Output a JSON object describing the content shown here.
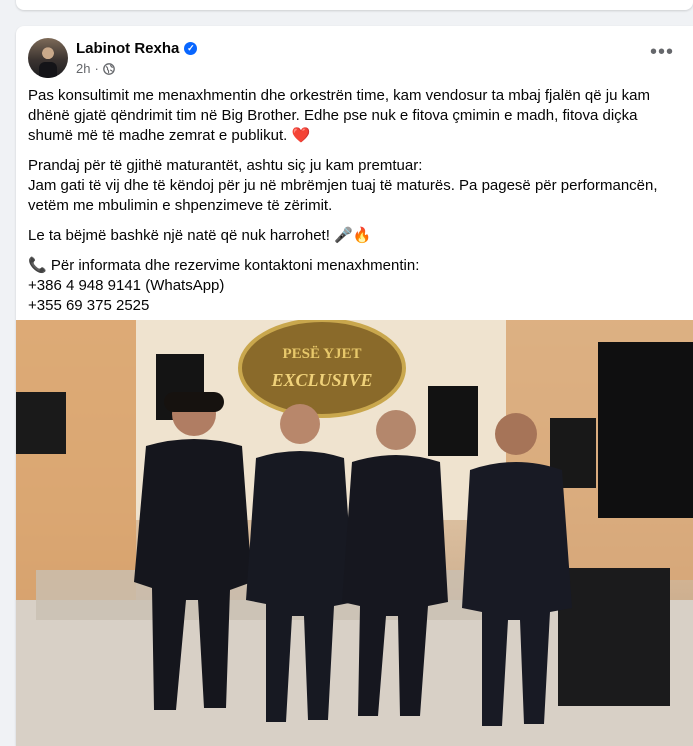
{
  "post": {
    "author": "Labinot Rexha",
    "time": "2h",
    "dot": "·",
    "more_label": "•••",
    "verified_glyph": "✓",
    "paragraphs": [
      {
        "lines": [
          "Pas konsultimit me menaxhmentin dhe orkestrën time, kam vendosur ta mbaj fjalën që ju kam",
          "dhënë gjatë qëndrimit tim në Big Brother. Edhe pse nuk e fitova çmimin e madh, fitova diçka",
          "shumë më të madhe zemrat e publikut. ❤️"
        ]
      },
      {
        "lines": [
          "Prandaj për të gjithë maturantët, ashtu siç ju kam premtuar:",
          "Jam gati të vij dhe të këndoj për ju në mbrëmjen tuaj të maturës. Pa pagesë për performancën,",
          "vetëm me mbulimin e shpenzimeve të zërimit."
        ]
      },
      {
        "lines": [
          "Le ta bëjmë bashkë një natë që nuk harrohet! 🎤🔥"
        ]
      },
      {
        "lines": [
          "📞 Për informata dhe rezervime kontaktoni menaxhmentin:",
          "+386 4 948 9141 (WhatsApp)",
          "+355 69 375 2525"
        ]
      }
    ],
    "photo_sign": [
      "PESË YJET",
      "EXCLUSIVE"
    ]
  },
  "colors": {
    "accent": "#0866ff",
    "meta_text": "#65676b",
    "background": "#f0f2f5"
  },
  "icons": {
    "verified": "verified-badge-icon",
    "privacy": "globe-icon",
    "menu": "more-icon"
  }
}
